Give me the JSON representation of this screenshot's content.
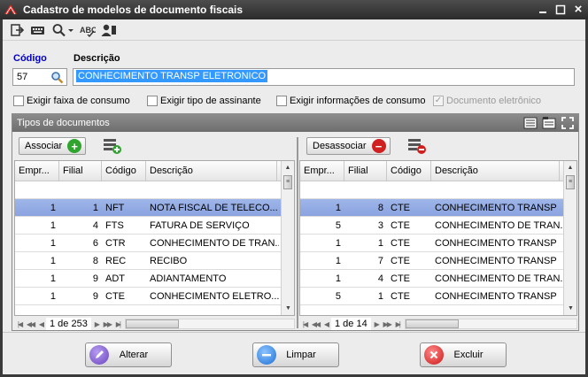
{
  "window": {
    "title": "Cadastro de modelos de documento fiscais",
    "close_glyph": "×"
  },
  "form": {
    "codigo_label": "Código",
    "codigo_value": "57",
    "descricao_label": "Descrição",
    "descricao_value": "CONHECIMENTO TRANSP ELETRONICO"
  },
  "checkboxes": [
    {
      "label": "Exigir faixa de consumo",
      "checked": false,
      "disabled": false
    },
    {
      "label": "Exigir tipo de assinante",
      "checked": false,
      "disabled": false
    },
    {
      "label": "Exigir informações de consumo",
      "checked": false,
      "disabled": false
    },
    {
      "label": "Documento eletrônico",
      "checked": true,
      "disabled": true
    }
  ],
  "panel": {
    "title": "Tipos de documentos"
  },
  "left": {
    "button_label": "Associar",
    "columns": [
      "Empr...",
      "Filial",
      "Código",
      "Descrição"
    ],
    "rows": [
      [
        "1",
        "1",
        "NFT",
        "NOTA FISCAL DE TELECO..."
      ],
      [
        "1",
        "4",
        "FTS",
        "FATURA DE SERVIÇO"
      ],
      [
        "1",
        "6",
        "CTR",
        "CONHECIMENTO DE TRAN..."
      ],
      [
        "1",
        "8",
        "REC",
        "RECIBO"
      ],
      [
        "1",
        "9",
        "ADT",
        "ADIANTAMENTO"
      ],
      [
        "1",
        "9",
        "CTE",
        "CONHECIMENTO ELETRO..."
      ]
    ],
    "selected_row": 0,
    "pager": "1 de 253"
  },
  "right": {
    "button_label": "Desassociar",
    "columns": [
      "Empr...",
      "Filial",
      "Código",
      "Descrição"
    ],
    "rows": [
      [
        "1",
        "8",
        "CTE",
        "CONHECIMENTO TRANSP"
      ],
      [
        "5",
        "3",
        "CTE",
        "CONHECIMENTO DE TRAN..."
      ],
      [
        "1",
        "1",
        "CTE",
        "CONHECIMENTO TRANSP"
      ],
      [
        "1",
        "7",
        "CTE",
        "CONHECIMENTO TRANSP"
      ],
      [
        "1",
        "4",
        "CTE",
        "CONHECIMENTO DE TRAN..."
      ],
      [
        "5",
        "1",
        "CTE",
        "CONHECIMENTO TRANSP"
      ]
    ],
    "selected_row": 0,
    "pager": "1 de 14"
  },
  "footer": {
    "alterar": "Alterar",
    "limpar": "Limpar",
    "excluir": "Excluir"
  },
  "colors": {
    "selection": "#3399ff",
    "grid_selected_row": "#8aa3df",
    "add": "#2fa52f",
    "remove": "#d11f1f",
    "limpar": "#2f7fe0",
    "alterar": "#7b5acb"
  }
}
